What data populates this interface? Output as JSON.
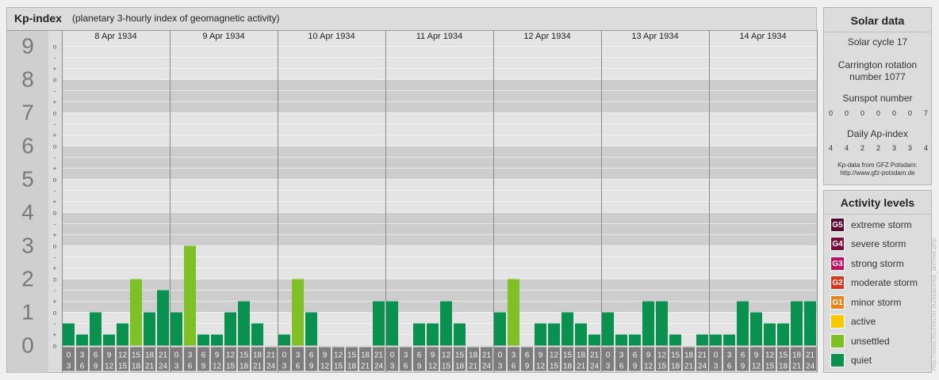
{
  "header": {
    "title": "Kp-index",
    "subtitle": "(planetary 3-hourly index of geomagnetic activity)"
  },
  "chart_data": {
    "type": "bar",
    "title": "Kp-index",
    "subtitle": "(planetary 3-hourly index of geomagnetic activity)",
    "ylim": [
      0,
      9
    ],
    "y_ticks": [
      "0",
      "1",
      "2",
      "3",
      "4",
      "5",
      "6",
      "7",
      "8",
      "9"
    ],
    "minor_tick_labels": [
      "o",
      "+",
      "-"
    ],
    "days": [
      "8 Apr 1934",
      "9 Apr 1934",
      "10 Apr 1934",
      "11 Apr 1934",
      "12 Apr 1934",
      "13 Apr 1934",
      "14 Apr 1934"
    ],
    "interval_labels": [
      {
        "top": "0",
        "bottom": "3"
      },
      {
        "top": "3",
        "bottom": "6"
      },
      {
        "top": "6",
        "bottom": "9"
      },
      {
        "top": "9",
        "bottom": "12"
      },
      {
        "top": "12",
        "bottom": "15"
      },
      {
        "top": "15",
        "bottom": "18"
      },
      {
        "top": "18",
        "bottom": "21"
      },
      {
        "top": "21",
        "bottom": "24"
      }
    ],
    "values": [
      [
        0.667,
        0.333,
        1.0,
        0.333,
        0.667,
        2.0,
        1.0,
        1.667
      ],
      [
        1.0,
        3.0,
        0.333,
        0.333,
        1.0,
        1.333,
        0.667,
        0.0
      ],
      [
        0.333,
        2.0,
        1.0,
        0.0,
        0.0,
        0.0,
        0.0,
        1.333
      ],
      [
        1.333,
        0.0,
        0.667,
        0.667,
        1.333,
        0.667,
        0.0,
        0.0
      ],
      [
        1.0,
        2.0,
        0.0,
        0.667,
        0.667,
        1.0,
        0.667,
        0.333
      ],
      [
        1.0,
        0.333,
        0.333,
        1.333,
        1.333,
        0.333,
        0.0,
        0.333
      ],
      [
        0.333,
        0.333,
        1.333,
        1.0,
        0.667,
        0.667,
        1.333,
        1.333
      ]
    ],
    "colors": {
      "quiet": "#0a9150",
      "unsettled": "#7ec026"
    }
  },
  "solar": {
    "title": "Solar data",
    "cycle": "Solar cycle 17",
    "carrington_1": "Carrington rotation",
    "carrington_2": "number 1077",
    "sunspot_label": "Sunspot number",
    "sunspot_values": [
      "0",
      "0",
      "0",
      "0",
      "0",
      "0",
      "7"
    ],
    "ap_label": "Daily Ap-index",
    "ap_values": [
      "4",
      "4",
      "2",
      "2",
      "3",
      "3",
      "4"
    ],
    "source_1": "Kp-data from GFZ Potsdam:",
    "source_2": "http://www.gfz-potsdam.de"
  },
  "activity": {
    "title": "Activity levels",
    "levels": [
      {
        "badge": "G5",
        "label": "extreme storm",
        "color": "#5a0a30"
      },
      {
        "badge": "G4",
        "label": "severe storm",
        "color": "#7a0c3c"
      },
      {
        "badge": "G3",
        "label": "strong storm",
        "color": "#c01060"
      },
      {
        "badge": "G2",
        "label": "moderate storm",
        "color": "#d8361e"
      },
      {
        "badge": "G1",
        "label": "minor storm",
        "color": "#e8841e"
      },
      {
        "badge": "",
        "label": "active",
        "color": "#f8c800"
      },
      {
        "badge": "",
        "label": "unsettled",
        "color": "#7ec026"
      },
      {
        "badge": "",
        "label": "quiet",
        "color": "#0a9150"
      }
    ]
  },
  "credit": "http://www.fleurseuler.eu/space/kp_archive.php"
}
